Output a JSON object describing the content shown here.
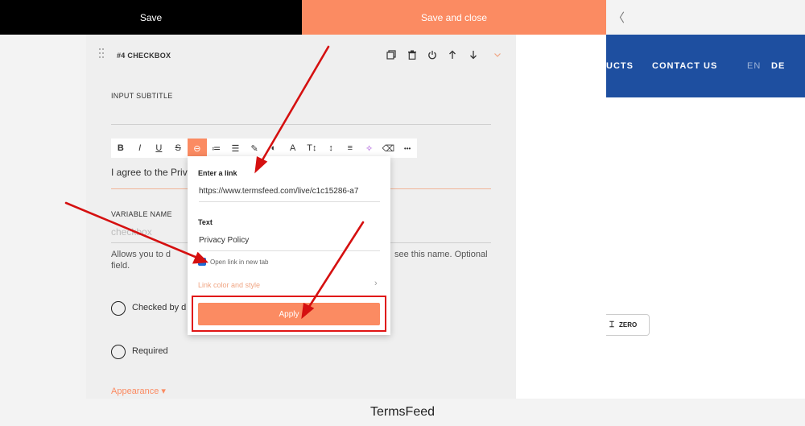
{
  "topbar": {
    "save_label": "Save",
    "save_close_label": "Save and close",
    "back_glyph": "〈"
  },
  "site_preview": {
    "nav_products": "UCTS",
    "nav_contact": "CONTACT US",
    "lang_en": "EN",
    "lang_de": "DE",
    "badge_label": "ZERO",
    "nav_color": "#1e4fa0"
  },
  "block": {
    "title": "#4 CHECKBOX",
    "tools": [
      "copy-icon",
      "trash-icon",
      "power-icon",
      "arrow-up-icon",
      "arrow-down-icon",
      "chevron-down-icon"
    ]
  },
  "form": {
    "input_subtitle_label": "INPUT SUBTITLE",
    "subtitle_text": "I agree to the Priv",
    "variable_name_label": "VARIABLE NAME",
    "variable_placeholder": "checkbox",
    "help_left": "Allows you to d",
    "help_right": "see this name. Optional",
    "help_line2": "field.",
    "option_checked": "Checked by d",
    "option_required": "Required",
    "appearance_label": "Appearance ▾"
  },
  "rte_toolbar": {
    "buttons": [
      {
        "name": "bold-icon",
        "glyph": "B"
      },
      {
        "name": "italic-icon",
        "glyph": "I"
      },
      {
        "name": "underline-icon",
        "glyph": "U"
      },
      {
        "name": "strikethrough-icon",
        "glyph": "S"
      },
      {
        "name": "link-icon",
        "glyph": "⊖",
        "active": true
      },
      {
        "name": "ordered-list-icon",
        "glyph": "≔"
      },
      {
        "name": "unordered-list-icon",
        "glyph": "☰"
      },
      {
        "name": "pen-icon",
        "glyph": "✎"
      },
      {
        "name": "color-icon",
        "glyph": "◐"
      },
      {
        "name": "font-icon",
        "glyph": "A"
      },
      {
        "name": "font-size-icon",
        "glyph": "T↕"
      },
      {
        "name": "line-height-icon",
        "glyph": "↕"
      },
      {
        "name": "align-icon",
        "glyph": "≡"
      },
      {
        "name": "magic-icon",
        "glyph": "✧"
      },
      {
        "name": "eraser-icon",
        "glyph": "⌫"
      },
      {
        "name": "more-icon",
        "glyph": "•••"
      }
    ]
  },
  "link_popup": {
    "link_label": "Enter a link",
    "link_value": "https://www.termsfeed.com/live/c1c15286-a7",
    "text_label": "Text",
    "text_value": "Privacy Policy",
    "open_new_tab": "Open link in new tab",
    "open_new_tab_checked": true,
    "link_style": "Link color and style",
    "apply_label": "Apply"
  },
  "colors": {
    "accent": "#fb8b62",
    "highlight": "#e01515"
  },
  "footer": {
    "text": "TermsFeed"
  }
}
